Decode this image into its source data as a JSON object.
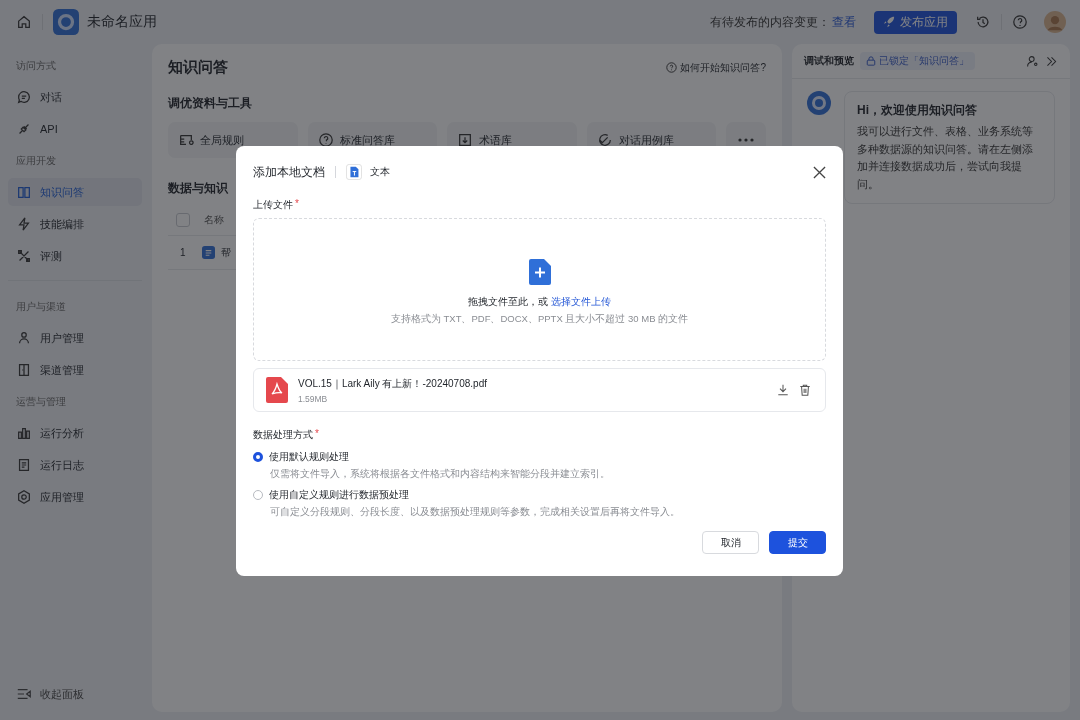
{
  "topbar": {
    "app_name": "未命名应用",
    "pending_label": "有待发布的内容变更：",
    "pending_link": "查看",
    "publish_button": "发布应用"
  },
  "sidebar": {
    "sections": [
      {
        "title": "访问方式",
        "items": [
          {
            "label": "对话",
            "selected": false
          },
          {
            "label": "API",
            "selected": false
          }
        ]
      },
      {
        "title": "应用开发",
        "items": [
          {
            "label": "知识问答",
            "selected": true
          },
          {
            "label": "技能编排",
            "selected": false
          },
          {
            "label": "评测",
            "selected": false
          }
        ]
      },
      {
        "title": "用户与渠道",
        "items": [
          {
            "label": "用户管理",
            "selected": false
          },
          {
            "label": "渠道管理",
            "selected": false
          }
        ]
      },
      {
        "title": "运营与管理",
        "items": [
          {
            "label": "运行分析",
            "selected": false
          },
          {
            "label": "运行日志",
            "selected": false
          },
          {
            "label": "应用管理",
            "selected": false
          }
        ]
      }
    ],
    "collapse": "收起面板"
  },
  "main": {
    "title": "知识问答",
    "help_link": "如何开始知识问答?",
    "tools_title": "调优资料与工具",
    "tools": [
      "全局规则",
      "标准问答库",
      "术语库",
      "对话用例库"
    ],
    "data_title": "数据与知识",
    "table": {
      "select_all": {
        "checked": false
      },
      "columns": [
        "名称"
      ],
      "rows": [
        {
          "index": "1",
          "name": "帮"
        }
      ]
    }
  },
  "preview": {
    "title": "调试和预览",
    "lock_badge": "已锁定「知识问答」",
    "greeting_title": "Hi，欢迎使用知识问答",
    "greeting_text": "我可以进行文件、表格、业务系统等多种数据源的知识问答。请在左侧添加并连接数据成功后，尝试向我提问。"
  },
  "dialog": {
    "title": "添加本地文档",
    "type_label": "文本",
    "upload_label": "上传文件",
    "upload_mark": "*",
    "drop_text": "拖拽文件至此，或",
    "drop_link": "选择文件上传",
    "hint": "支持格式为 TXT、PDF、DOCX、PPTX 且大小不超过 30 MB 的文件",
    "file": {
      "name": "VOL.15｜Lark Aily 有上新！-20240708.pdf",
      "size": "1.59MB"
    },
    "method_label": "数据处理方式",
    "method_mark": "*",
    "options": [
      {
        "label": "使用默认规则处理",
        "description": "仅需将文件导入，系统将根据各文件格式和内容结构来智能分段并建立索引。",
        "selected": true
      },
      {
        "label": "使用自定义规则进行数据预处理",
        "description": "可自定义分段规则、分段长度、以及数据预处理规则等参数，完成相关设置后再将文件导入。",
        "selected": false
      }
    ],
    "cancel": "取消",
    "submit": "提交"
  }
}
